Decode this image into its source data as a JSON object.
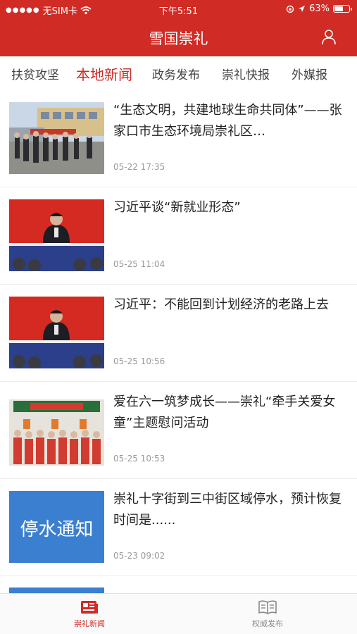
{
  "status_bar": {
    "carrier": "无SIM卡",
    "time": "下午5:51",
    "battery": "63%",
    "battery_level": 0.63
  },
  "header": {
    "title": "雪国崇礼",
    "user_icon": "user-icon"
  },
  "tabs": [
    {
      "label": "扶贫攻坚",
      "active": false
    },
    {
      "label": "本地新闻",
      "active": true
    },
    {
      "label": "政务发布",
      "active": false
    },
    {
      "label": "崇礼快报",
      "active": false
    },
    {
      "label": "外媒报",
      "active": false
    }
  ],
  "news": [
    {
      "title": "“生态文明，共建地球生命共同体”——张家口市生态环境局崇礼区…",
      "date": "05-22 17:35"
    },
    {
      "title": "习近平谈“新就业形态”",
      "date": "05-25 11:04"
    },
    {
      "title": "习近平：不能回到计划经济的老路上去",
      "date": "05-25 10:56"
    },
    {
      "title": "爱在六一筑梦成长——崇礼“牵手关爱女童”主题慰问活动",
      "date": "05-25 10:53"
    },
    {
      "title": "崇礼十字街到三中街区域停水，预计恢复时间是......",
      "date": "05-23 09:02",
      "thumb_text": "停水通知"
    }
  ],
  "bottom_nav": [
    {
      "label": "崇礼新闻",
      "icon": "newspaper-icon",
      "active": true
    },
    {
      "label": "权威发布",
      "icon": "book-icon",
      "active": false
    }
  ],
  "colors": {
    "brand_red": "#d12b25",
    "date_gray": "#9a9a9a",
    "notice_blue": "#3a7fd0"
  }
}
